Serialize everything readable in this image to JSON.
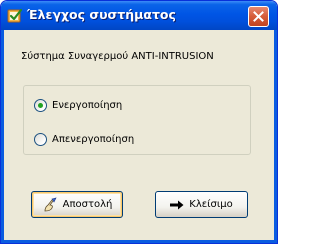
{
  "window": {
    "title": "Έλεγχος συστήματος",
    "icon": "checkbox-check-icon",
    "colors": {
      "titlebar": "#0055e5",
      "body": "#ece9d8",
      "close_button": "#d65c38"
    }
  },
  "content": {
    "system_label": "Σύστημα Συναγερμού ANTI-INTRUSION"
  },
  "options": {
    "items": [
      {
        "label": "Ενεργοποίηση",
        "selected": true
      },
      {
        "label": "Απενεργοποίηση",
        "selected": false
      }
    ]
  },
  "buttons": {
    "send": {
      "label": "Αποστολή",
      "icon": "hand-write-icon"
    },
    "close": {
      "label": "Κλείσιμο",
      "icon": "arrow-right-icon"
    }
  }
}
